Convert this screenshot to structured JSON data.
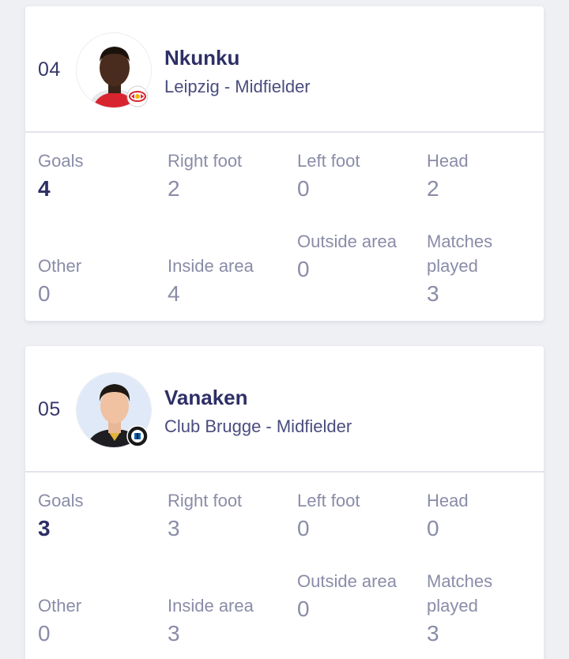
{
  "players": [
    {
      "rank": "04",
      "name": "Nkunku",
      "subtitle": "Leipzig - Midfielder",
      "avatar_icon": "player-photo-nkunku",
      "badge_icon": "rb-leipzig-crest-icon",
      "stats": {
        "goals": {
          "label": "Goals",
          "value": "4"
        },
        "right_foot": {
          "label": "Right foot",
          "value": "2"
        },
        "left_foot": {
          "label": "Left foot",
          "value": "0"
        },
        "head": {
          "label": "Head",
          "value": "2"
        },
        "other": {
          "label": "Other",
          "value": "0"
        },
        "inside_area": {
          "label": "Inside area",
          "value": "4"
        },
        "outside_area": {
          "label": "Outside area",
          "value": "0"
        },
        "matches_played": {
          "label": "Matches played",
          "value": "3"
        }
      }
    },
    {
      "rank": "05",
      "name": "Vanaken",
      "subtitle": "Club Brugge - Midfielder",
      "avatar_icon": "player-photo-vanaken",
      "badge_icon": "club-brugge-crest-icon",
      "stats": {
        "goals": {
          "label": "Goals",
          "value": "3"
        },
        "right_foot": {
          "label": "Right foot",
          "value": "3"
        },
        "left_foot": {
          "label": "Left foot",
          "value": "0"
        },
        "head": {
          "label": "Head",
          "value": "0"
        },
        "other": {
          "label": "Other",
          "value": "0"
        },
        "inside_area": {
          "label": "Inside area",
          "value": "3"
        },
        "outside_area": {
          "label": "Outside area",
          "value": "0"
        },
        "matches_played": {
          "label": "Matches played",
          "value": "3"
        }
      }
    }
  ],
  "colors": {
    "page_bg": "#eff0f4",
    "card_bg": "#ffffff",
    "primary_text": "#2e2f66",
    "muted_text": "#8a8ca8",
    "divider": "#e3e4ec"
  }
}
